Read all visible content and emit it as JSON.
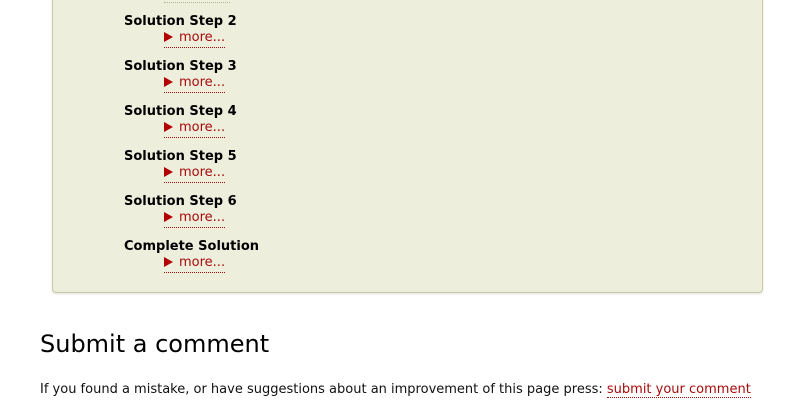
{
  "solution_steps": [
    {
      "title": "Solution Step 2",
      "more": "more..."
    },
    {
      "title": "Solution Step 3",
      "more": "more..."
    },
    {
      "title": "Solution Step 4",
      "more": "more..."
    },
    {
      "title": "Solution Step 5",
      "more": "more..."
    },
    {
      "title": "Solution Step 6",
      "more": "more..."
    },
    {
      "title": "Complete Solution",
      "more": "more..."
    }
  ],
  "comment_section": {
    "heading": "Submit a comment",
    "text": "If you found a mistake, or have suggestions about an improvement of this page press:",
    "link_label": "submit your comment"
  },
  "colors": {
    "panel_background": "#eeeedd",
    "link": "#a60b0b"
  },
  "icons": {
    "expand": "play-triangle-icon"
  }
}
